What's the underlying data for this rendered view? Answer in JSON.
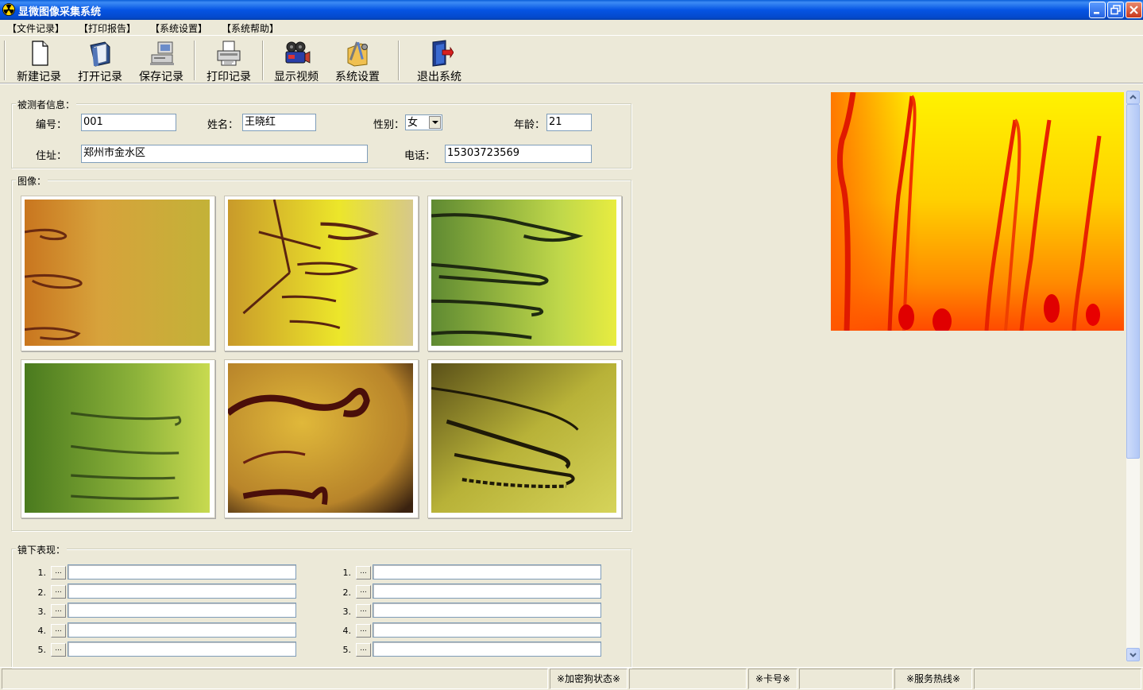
{
  "window": {
    "title": "显微图像采集系统",
    "controls": [
      "minimize",
      "restore",
      "close"
    ]
  },
  "menu": [
    "【文件记录】",
    "【打印报告】",
    "【系统设置】",
    "【系统帮助】"
  ],
  "toolbar": [
    {
      "label": "新建记录",
      "icon": "new-document-icon"
    },
    {
      "label": "打开记录",
      "icon": "open-folder-icon"
    },
    {
      "label": "保存记录",
      "icon": "save-computer-icon"
    },
    {
      "label": "打印记录",
      "icon": "printer-icon"
    },
    {
      "label": "显示视频",
      "icon": "video-camera-icon"
    },
    {
      "label": "系统设置",
      "icon": "tools-settings-icon"
    },
    {
      "label": "退出系统",
      "icon": "exit-door-icon"
    }
  ],
  "subject": {
    "section_label": "被测者信息：",
    "id_label": "编号：",
    "id_value": "001",
    "name_label": "姓名：",
    "name_value": "王晓红",
    "gender_label": "性别：",
    "gender_value": "女",
    "age_label": "年龄：",
    "age_value": "21",
    "address_label": "住址：",
    "address_value": "郑州市金水区",
    "phone_label": "电话：",
    "phone_value": "15303723569"
  },
  "images": {
    "section_label": "图像：",
    "thumbnails": [
      "capillary-image-1",
      "capillary-image-2",
      "capillary-image-3",
      "capillary-image-4",
      "capillary-image-5",
      "capillary-image-6"
    ]
  },
  "findings": {
    "section_label": "镜下表现：",
    "left_numbers": [
      "1.",
      "2.",
      "3.",
      "4.",
      "5."
    ],
    "right_numbers": [
      "1.",
      "2.",
      "3.",
      "4.",
      "5."
    ],
    "button_label": "...",
    "left_values": [
      "",
      "",
      "",
      "",
      ""
    ],
    "right_values": [
      "",
      "",
      "",
      "",
      ""
    ]
  },
  "status": {
    "dongle": "※加密狗状态※",
    "card": "※卡号※",
    "hotline": "※服务热线※"
  },
  "colors": {
    "window_bg": "#ece9d8",
    "titlebar": "#0554e3",
    "input_border": "#7f9db9"
  }
}
